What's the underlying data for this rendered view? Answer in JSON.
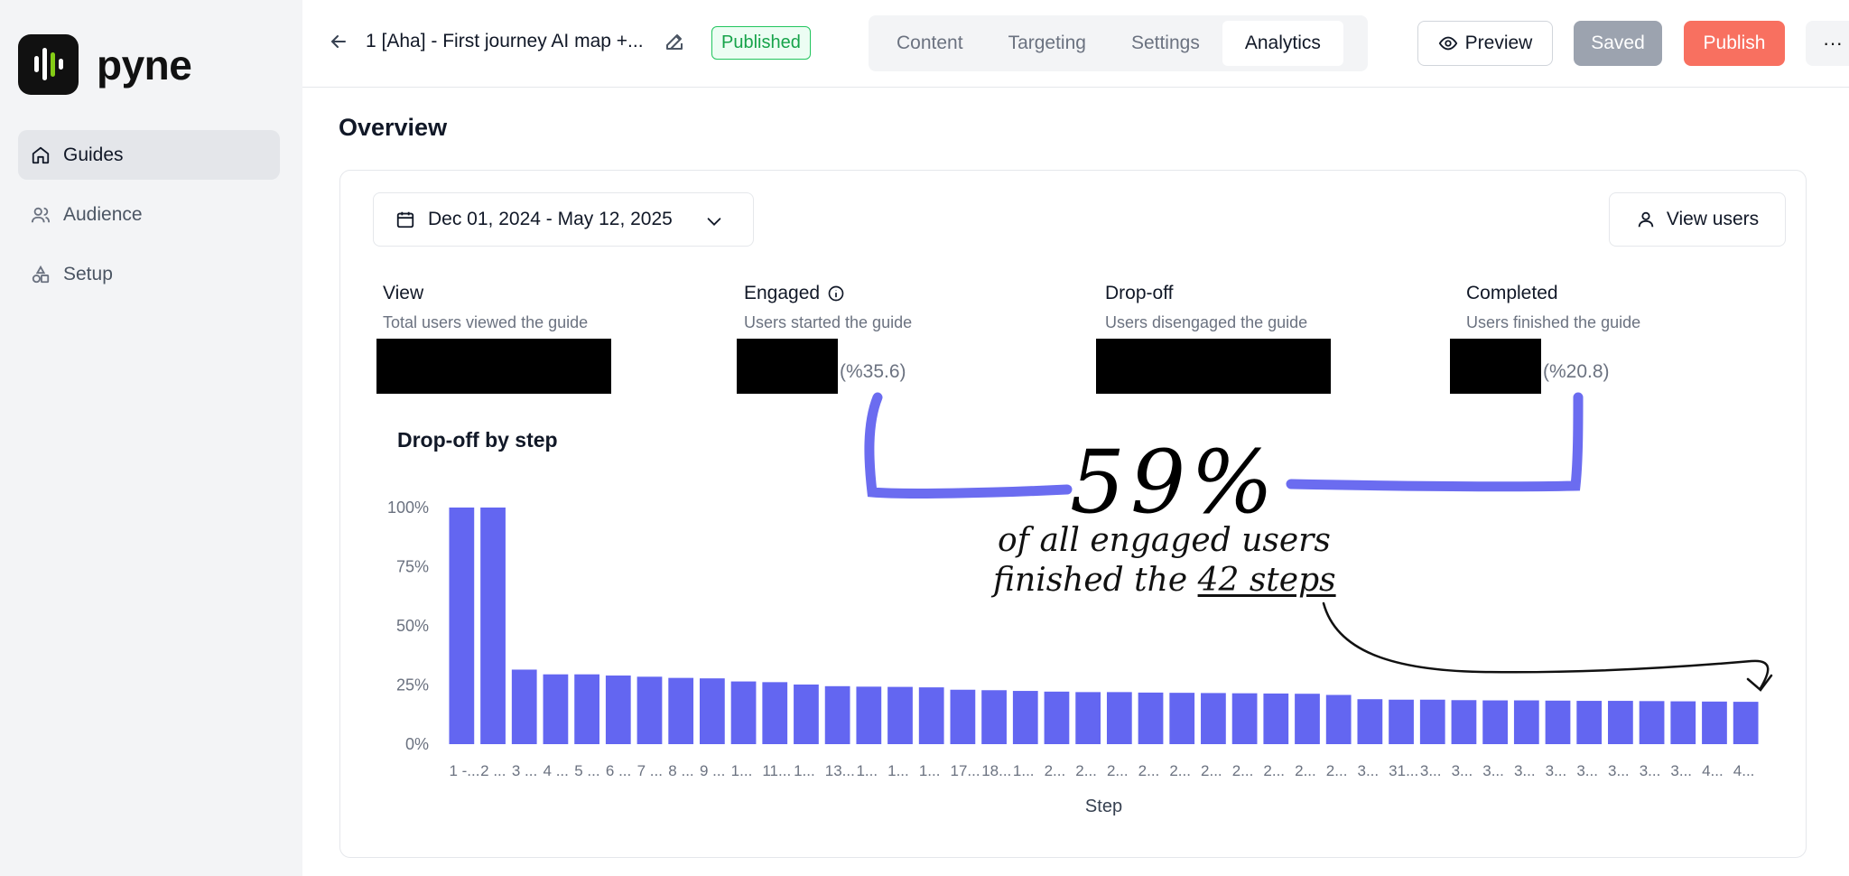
{
  "app": {
    "brand": "pyne"
  },
  "sidebar": {
    "items": [
      {
        "label": "Guides",
        "icon": "home-icon",
        "active": true
      },
      {
        "label": "Audience",
        "icon": "users-icon",
        "active": false
      },
      {
        "label": "Setup",
        "icon": "shapes-icon",
        "active": false
      }
    ]
  },
  "header": {
    "title": "1 [Aha] - First journey AI map +...",
    "status_badge": "Published",
    "tabs": [
      "Content",
      "Targeting",
      "Settings",
      "Analytics"
    ],
    "active_tab": "Analytics",
    "preview_label": "Preview",
    "saved_label": "Saved",
    "publish_label": "Publish",
    "more_label": "···"
  },
  "colors": {
    "accent": "#6366f1",
    "publish": "#f87060",
    "published_green": "#16a34a",
    "annotation": "#6b6cf0"
  },
  "main": {
    "title": "Overview",
    "date_range": "Dec 01, 2024 - May 12, 2025",
    "view_users_label": "View users",
    "stats": [
      {
        "title": "View",
        "subtitle": "Total users viewed the guide",
        "value_redacted": true,
        "pct": ""
      },
      {
        "title": "Engaged",
        "subtitle": "Users started the guide",
        "value_redacted": true,
        "pct": "(%35.6)",
        "info_icon": true
      },
      {
        "title": "Drop-off",
        "subtitle": "Users disengaged the guide",
        "value_redacted": true,
        "pct": ""
      },
      {
        "title": "Completed",
        "subtitle": "Users finished the guide",
        "value_redacted": true,
        "pct": "(%20.8)"
      }
    ]
  },
  "annotation": {
    "big_number": "59%",
    "line1": "of all engaged users",
    "line2_prefix": "finished the ",
    "line2_underlined": "42 steps"
  },
  "chart_data": {
    "type": "bar",
    "title": "Drop-off by step",
    "xlabel": "Step",
    "ylabel": "",
    "ylim": [
      0,
      100
    ],
    "y_ticks": [
      "100%",
      "75%",
      "50%",
      "25%",
      "0%"
    ],
    "categories": [
      "1 -...",
      "2 ...",
      "3 ...",
      "4 ...",
      "5 ...",
      "6 ...",
      "7 ...",
      "8 ...",
      "9 ...",
      "1...",
      "11...",
      "1...",
      "13...",
      "1...",
      "1...",
      "1...",
      "17...",
      "18...",
      "1...",
      "2...",
      "2...",
      "2...",
      "2...",
      "2...",
      "2...",
      "2...",
      "2...",
      "2...",
      "2...",
      "3...",
      "31...",
      "3...",
      "3...",
      "3...",
      "3...",
      "3...",
      "3...",
      "3...",
      "3...",
      "3...",
      "4...",
      "4..."
    ],
    "values": [
      100,
      100,
      31.5,
      29.5,
      29.5,
      29,
      28.5,
      28,
      27.8,
      26.5,
      26.2,
      25.2,
      24.5,
      24.3,
      24.2,
      24,
      23,
      22.8,
      22.5,
      22.2,
      22,
      22,
      21.8,
      21.7,
      21.6,
      21.5,
      21.4,
      21.3,
      20.8,
      19,
      18.8,
      18.8,
      18.6,
      18.5,
      18.5,
      18.4,
      18.3,
      18.3,
      18.2,
      18.1,
      18,
      17.9
    ],
    "grid": false,
    "legend": "none"
  }
}
